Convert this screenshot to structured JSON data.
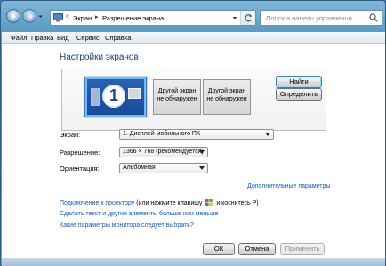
{
  "address": {
    "crumbs": [
      "Экран",
      "Разрешение экрана"
    ],
    "search_placeholder": "Поиск в панели управления"
  },
  "menu": [
    "Файл",
    "Правка",
    "Вид",
    "Сервис",
    "Справка"
  ],
  "content": {
    "title": "Настройки экранов",
    "monitors": {
      "primary_number": "1",
      "other1": "Другой экран не обнаружен",
      "other2": "Другой экран не обнаружен"
    },
    "find_button": "Найти",
    "detect_button": "Определить",
    "screen_label": "Экран:",
    "screen_value": "1. Дисплей мобильного ПК",
    "resolution_label": "Разрешение:",
    "resolution_value": "1366 × 768 (рекомендуется)",
    "orientation_label": "Ориентация:",
    "orientation_value": "Альбомная",
    "advanced_link": "Дополнительные параметры",
    "projector_link": "Подключение к проектору",
    "projector_hint_a": " (или нажмите клавишу ",
    "projector_hint_b": " и коснитесь P)",
    "text_size_link": "Сделать текст и другие элементы больше или меньше",
    "monitor_params_link": "Какие параметры монитора следует выбрать?",
    "ok": "ОК",
    "cancel": "Отмена",
    "apply": "Применить"
  },
  "colors": {
    "link": "#1a59b5",
    "title": "#1e3d6e",
    "selected_monitor": "#2a61b0"
  }
}
